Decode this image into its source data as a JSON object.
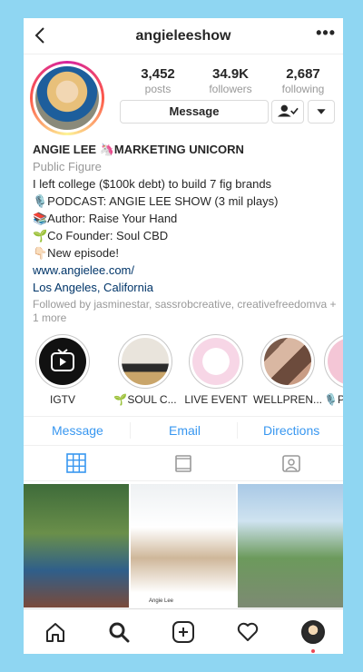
{
  "header": {
    "username": "angieleeshow",
    "back_icon": "chevron-left-icon",
    "more_icon": "ellipsis-icon",
    "more_label": "•••"
  },
  "stats": [
    {
      "value": "3,452",
      "label": "posts"
    },
    {
      "value": "34.9K",
      "label": "followers"
    },
    {
      "value": "2,687",
      "label": "following"
    }
  ],
  "actions": {
    "message_label": "Message",
    "following_icon": "person-check-icon",
    "dropdown_icon": "caret-down-icon"
  },
  "bio": {
    "name": "ANGIE LEE 🦄MARKETING UNICORN",
    "category": "Public Figure",
    "lines": [
      "I left college ($100k debt) to build 7 fig brands",
      "🎙️PODCAST: ANGIE LEE SHOW (3 mil plays)",
      "📚Author: Raise Your Hand",
      "🌱Co Founder: Soul CBD",
      "👇🏻New episode!"
    ],
    "website": "www.angielee.com/",
    "location": "Los Angeles, California",
    "followed_by": "Followed by jasminestar, sassrobcreative, creativefreedomva + 1 more"
  },
  "highlights": [
    {
      "label": "IGTV",
      "icon": "igtv-icon"
    },
    {
      "label": "🌱SOUL C..."
    },
    {
      "label": "LIVE EVENT"
    },
    {
      "label": "WELLPREN..."
    },
    {
      "label": "🎙️P"
    }
  ],
  "contact": {
    "message": "Message",
    "email": "Email",
    "directions": "Directions"
  },
  "tabs": [
    {
      "icon": "grid-icon",
      "active": true
    },
    {
      "icon": "igtv-tab-icon",
      "active": false
    },
    {
      "icon": "tagged-icon",
      "active": false
    }
  ],
  "grid_caption": "Angie Lee",
  "bottom_nav": [
    {
      "icon": "home-icon"
    },
    {
      "icon": "search-icon"
    },
    {
      "icon": "add-post-icon"
    },
    {
      "icon": "heart-icon"
    },
    {
      "icon": "profile-avatar-icon"
    }
  ],
  "colors": {
    "link": "#3897f0",
    "background": "#8fd6f2",
    "notification_dot": "#ed4956"
  }
}
